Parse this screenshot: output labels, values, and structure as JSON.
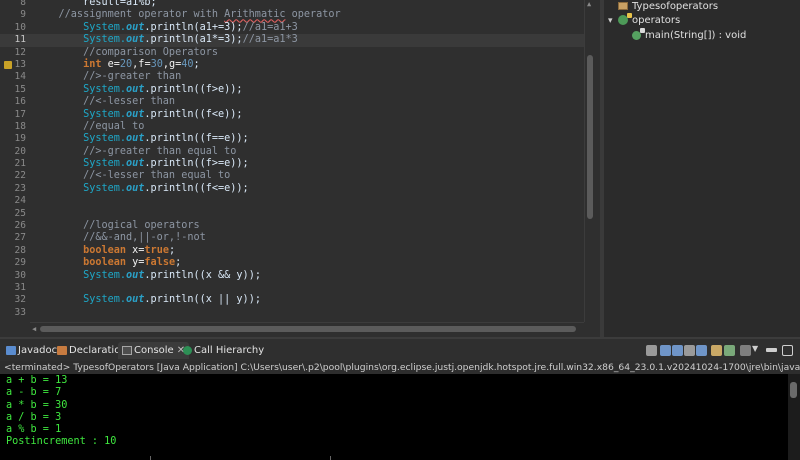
{
  "editor": {
    "lines": [
      {
        "n": "8",
        "tokens": [
          {
            "t": "        result=a1%b;",
            "c": "pl"
          }
        ]
      },
      {
        "n": "9",
        "tokens": [
          {
            "t": "    //assignment operator with ",
            "c": "cm"
          },
          {
            "t": "Arithmatic",
            "c": "cm",
            "sq": true
          },
          {
            "t": " operator",
            "c": "cm"
          }
        ]
      },
      {
        "n": "10",
        "tokens": [
          {
            "t": "        ",
            "c": "pl"
          },
          {
            "t": "System.",
            "c": "sys"
          },
          {
            "t": "out",
            "c": "out"
          },
          {
            "t": ".println(a1+=3);",
            "c": "pl"
          },
          {
            "t": "//a1=a1+3",
            "c": "cm"
          }
        ]
      },
      {
        "n": "11",
        "current": true,
        "tokens": [
          {
            "t": "        ",
            "c": "pl"
          },
          {
            "t": "System.",
            "c": "sys"
          },
          {
            "t": "out",
            "c": "out"
          },
          {
            "t": ".println(a1*=3);",
            "c": "pl"
          },
          {
            "t": "//a1=a1*3",
            "c": "cm"
          }
        ]
      },
      {
        "n": "12",
        "tokens": [
          {
            "t": "        //comparison Operators",
            "c": "cm"
          }
        ]
      },
      {
        "n": "13",
        "marker": true,
        "tokens": [
          {
            "t": "        ",
            "c": "pl"
          },
          {
            "t": "int",
            "c": "kw"
          },
          {
            "t": " e=",
            "c": "var"
          },
          {
            "t": "20",
            "c": "num"
          },
          {
            "t": ",f=",
            "c": "var"
          },
          {
            "t": "30",
            "c": "num"
          },
          {
            "t": ",g=",
            "c": "var"
          },
          {
            "t": "40",
            "c": "num"
          },
          {
            "t": ";",
            "c": "pl"
          }
        ]
      },
      {
        "n": "14",
        "tokens": [
          {
            "t": "        //>-greater than",
            "c": "cm"
          }
        ]
      },
      {
        "n": "15",
        "tokens": [
          {
            "t": "        ",
            "c": "pl"
          },
          {
            "t": "System.",
            "c": "sys"
          },
          {
            "t": "out",
            "c": "out"
          },
          {
            "t": ".println((f>e));",
            "c": "pl"
          }
        ]
      },
      {
        "n": "16",
        "tokens": [
          {
            "t": "        //<-lesser than",
            "c": "cm"
          }
        ]
      },
      {
        "n": "17",
        "tokens": [
          {
            "t": "        ",
            "c": "pl"
          },
          {
            "t": "System.",
            "c": "sys"
          },
          {
            "t": "out",
            "c": "out"
          },
          {
            "t": ".println((f<e));",
            "c": "pl"
          }
        ]
      },
      {
        "n": "18",
        "tokens": [
          {
            "t": "        //equal to",
            "c": "cm"
          }
        ]
      },
      {
        "n": "19",
        "tokens": [
          {
            "t": "        ",
            "c": "pl"
          },
          {
            "t": "System.",
            "c": "sys"
          },
          {
            "t": "out",
            "c": "out"
          },
          {
            "t": ".println((f==e));",
            "c": "pl"
          }
        ]
      },
      {
        "n": "20",
        "tokens": [
          {
            "t": "        //>-greater than equal to",
            "c": "cm"
          }
        ]
      },
      {
        "n": "21",
        "tokens": [
          {
            "t": "        ",
            "c": "pl"
          },
          {
            "t": "System.",
            "c": "sys"
          },
          {
            "t": "out",
            "c": "out"
          },
          {
            "t": ".println((f>=e));",
            "c": "pl"
          }
        ]
      },
      {
        "n": "22",
        "tokens": [
          {
            "t": "        //<-lesser than equal to",
            "c": "cm"
          }
        ]
      },
      {
        "n": "23",
        "tokens": [
          {
            "t": "        ",
            "c": "pl"
          },
          {
            "t": "System.",
            "c": "sys"
          },
          {
            "t": "out",
            "c": "out"
          },
          {
            "t": ".println((f<=e));",
            "c": "pl"
          }
        ]
      },
      {
        "n": "24",
        "tokens": []
      },
      {
        "n": "25",
        "tokens": []
      },
      {
        "n": "26",
        "tokens": [
          {
            "t": "        //logical operators",
            "c": "cm"
          }
        ]
      },
      {
        "n": "27",
        "tokens": [
          {
            "t": "        //&&-and,||-or,!-not",
            "c": "cm"
          }
        ]
      },
      {
        "n": "28",
        "tokens": [
          {
            "t": "        ",
            "c": "pl"
          },
          {
            "t": "boolean",
            "c": "kw"
          },
          {
            "t": " x=",
            "c": "var"
          },
          {
            "t": "true",
            "c": "kw"
          },
          {
            "t": ";",
            "c": "pl"
          }
        ]
      },
      {
        "n": "29",
        "tokens": [
          {
            "t": "        ",
            "c": "pl"
          },
          {
            "t": "boolean",
            "c": "kw"
          },
          {
            "t": " y=",
            "c": "var"
          },
          {
            "t": "false",
            "c": "kw"
          },
          {
            "t": ";",
            "c": "pl"
          }
        ]
      },
      {
        "n": "30",
        "tokens": [
          {
            "t": "        ",
            "c": "pl"
          },
          {
            "t": "System.",
            "c": "sys"
          },
          {
            "t": "out",
            "c": "out"
          },
          {
            "t": ".println((x && y));",
            "c": "pl"
          }
        ]
      },
      {
        "n": "31",
        "tokens": []
      },
      {
        "n": "32",
        "tokens": [
          {
            "t": "        ",
            "c": "pl"
          },
          {
            "t": "System.",
            "c": "sys"
          },
          {
            "t": "out",
            "c": "out"
          },
          {
            "t": ".println((x || y));",
            "c": "pl"
          }
        ]
      },
      {
        "n": "33",
        "tokens": []
      }
    ]
  },
  "outline": {
    "package": "Typesofoperators",
    "class": "operators",
    "method": "main(String[]) : void"
  },
  "panel": {
    "tabs": [
      {
        "label": "Javadoc",
        "icon": "javadoc-icon"
      },
      {
        "label": "Declaration",
        "icon": "declaration-icon"
      },
      {
        "label": "Console",
        "icon": "console-icon",
        "active": true
      },
      {
        "label": "Call Hierarchy",
        "icon": "call-hierarchy-icon"
      }
    ],
    "terminated": "<terminated> TypesofOperators [Java Application] C:\\Users\\user\\.p2\\pool\\plugins\\org.eclipse.justj.openjdk.hotspot.jre.full.win32.x86_64_23.0.1.v20241024-1700\\jre\\bin\\javaw.exe  (Dec 19",
    "console_lines": [
      "a + b = 13",
      "a - b = 7",
      "a * b = 30",
      "a / b = 3",
      "a % b = 1",
      "Postincrement : 10"
    ]
  },
  "colors": {
    "console_text": "#3fe83f",
    "editor_bg": "#2f2f2f",
    "keyword": "#cc7832",
    "system_out": "#1ea8c8"
  }
}
